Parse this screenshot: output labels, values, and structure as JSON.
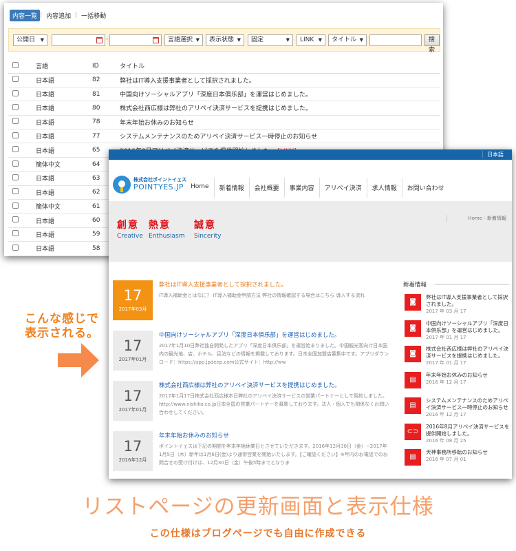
{
  "admin": {
    "nav": [
      "内容一覧",
      "内容追加",
      "一括移動"
    ],
    "filters": {
      "date_select": "公開日",
      "lang_select": "言語選択",
      "status_select": "表示状態",
      "fixed_select": "固定",
      "link_select": "LINK",
      "title_select": "タイトル",
      "search_button": "搜索",
      "dash": "-"
    },
    "columns": [
      "言語",
      "ID",
      "タイトル"
    ],
    "rows": [
      {
        "lang": "日本語",
        "id": "82",
        "title": "弊社はIT導入支援事業者として採択されました。"
      },
      {
        "lang": "日本語",
        "id": "81",
        "title": "中国向けソーシャルアプリ「深度日本俱乐部」を運営はじめました。"
      },
      {
        "lang": "日本語",
        "id": "80",
        "title": "株式会社西広様は弊社のアリペイ決済サービスを提携はじめました。"
      },
      {
        "lang": "日本語",
        "id": "78",
        "title": "年末年始お休みのお知らせ"
      },
      {
        "lang": "日本語",
        "id": "77",
        "title": "システムメンテナンスのためアリペイ決済サービス一時停止のお知らせ"
      },
      {
        "lang": "日本語",
        "id": "65",
        "title": "2016年8月アリペイ決済サービスを提供開始しました。",
        "tag": "[LINK]"
      },
      {
        "lang": "簡体中文",
        "id": "64",
        "title": ""
      },
      {
        "lang": "日本語",
        "id": "63",
        "title": ""
      },
      {
        "lang": "日本語",
        "id": "62",
        "title": ""
      },
      {
        "lang": "簡体中文",
        "id": "61",
        "title": ""
      },
      {
        "lang": "日本語",
        "id": "60",
        "title": ""
      },
      {
        "lang": "日本語",
        "id": "59",
        "title": ""
      },
      {
        "lang": "日本語",
        "id": "58",
        "title": ""
      }
    ]
  },
  "site": {
    "lang_button": "日本語",
    "logo_jp": "株式会社ポイントイェス",
    "logo_en": "POINTYES.JP",
    "menu": [
      "Home",
      "新着情報",
      "会社概要",
      "事業内容",
      "アリペイ決済",
      "求人情報",
      "お問い合わせ"
    ],
    "hero": [
      {
        "kanji": "創意",
        "en_initial": "C",
        "en_rest": "reative"
      },
      {
        "kanji": "熱意",
        "en_initial": "E",
        "en_rest": "nthusiasm"
      },
      {
        "kanji": "誠意",
        "en_initial": "S",
        "en_rest": "incerity"
      }
    ],
    "breadcrumb": "Home - 新着情報",
    "entries": [
      {
        "day": "17",
        "ym": "2017年03月",
        "title": "弊社はIT導入支援事業者として採択されました。",
        "body": "IT導入補助金とはなに？ IT導入補助金申請方法 弊社の情報確認する場合はこちら 導入する流れ"
      },
      {
        "day": "17",
        "ym": "2017年01月",
        "title": "中国向けソーシャルアプリ「深度日本俱乐部」を運営はじめました。",
        "body": "2017年1月10日弊社独自開発したアプリ「深度日本俱乐部」を運営始まりました。中国観光客向け日本国内の観光地、店、ホテル、民泊などの情報を掲載しております。日本全国加盟店募集中です。アプリダウンロード：https://app.jpdeep.com公式サイト：http://ww"
      },
      {
        "day": "17",
        "ym": "2017年01月",
        "title": "株式会社西広様は弊社のアリペイ決済サービスを提携はじめました。",
        "body": "2017年1月17日株式会社西広様本日弊社のアリペイ決済サービスの営業パートナーとして契約しました。http://www.nishiko.co.jp日本全国の営業パートナーを募集しております。法人・個人でも関係なくお問い合わせしてください。"
      },
      {
        "day": "17",
        "ym": "2016年12月",
        "title": "年末年始お休みのお知らせ",
        "body": "ポイントイェスは下記の期間を年末年始休業日とさせていただきます。2016年12月30日（金）~2017年1月5日（木）新年は1月6日(金)より通常営業を開始いたします。【ご確認ください】※年内のお電話でのお問合せの受け付けは、12月30日（金）午後5時までとなりま"
      }
    ],
    "side": {
      "title": "新着情報",
      "items": [
        {
          "icon": "camera-icon",
          "title": "弊社はIT導入支援事業者として採択されました。",
          "date": "2017 年 03 月 17"
        },
        {
          "icon": "camera-icon",
          "title": "中国向けソーシャルアプリ「深度日本俱乐部」を運営はじめました。",
          "date": "2017 年 01 月 17"
        },
        {
          "icon": "camera-icon",
          "title": "株式会社西広様は弊社のアリペイ決済サービスを提携はじめました。",
          "date": "2017 年 01 月 17"
        },
        {
          "icon": "document-icon",
          "title": "年末年始お休みのお知らせ",
          "date": "2016 年 12 月 17"
        },
        {
          "icon": "document-icon",
          "title": "システムメンテナンスのためアリペイ決済サービス一時停止のお知らせ",
          "date": "2016 年 12 月 17"
        },
        {
          "icon": "link-icon",
          "title": "2016年8月アリペイ決済サービスを提供開始しました。",
          "date": "2016 年 08 月 25"
        },
        {
          "icon": "document-icon",
          "title": "天神事務所移転のお知らせ",
          "date": "2016 年 07 月 01"
        }
      ]
    }
  },
  "annotations": {
    "callout_line1": "こんな感じで",
    "callout_line2": "表示される。",
    "caption": "リストページの更新画面と表示仕様",
    "subcaption": "この仕様はブログページでも自由に作成できる"
  },
  "colors": {
    "accent_orange": "#f39213",
    "brand_blue": "#1565a8",
    "icon_red": "#e71f20"
  }
}
